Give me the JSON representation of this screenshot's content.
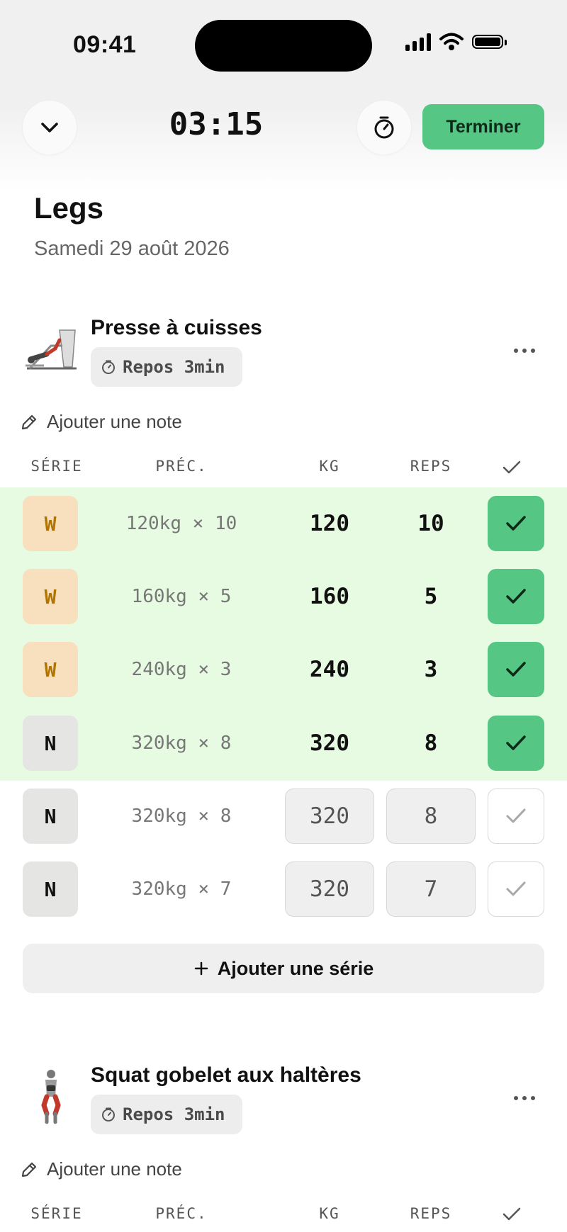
{
  "status_bar": {
    "time": "09:41"
  },
  "header": {
    "timer": "03:15",
    "finish_label": "Terminer"
  },
  "workout": {
    "title": "Legs",
    "date": "Samedi 29 août 2026"
  },
  "columns": {
    "set": "SÉRIE",
    "prev": "PRÉC.",
    "kg": "KG",
    "reps": "REPS"
  },
  "exercises": [
    {
      "name": "Presse à cuisses",
      "rest": "Repos 3min",
      "note_label": "Ajouter une note",
      "sets": [
        {
          "type": "W",
          "prev": "120kg × 10",
          "kg": "120",
          "reps": "10",
          "done": true
        },
        {
          "type": "W",
          "prev": "160kg × 5",
          "kg": "160",
          "reps": "5",
          "done": true
        },
        {
          "type": "W",
          "prev": "240kg × 3",
          "kg": "240",
          "reps": "3",
          "done": true
        },
        {
          "type": "N",
          "prev": "320kg × 8",
          "kg": "320",
          "reps": "8",
          "done": true
        },
        {
          "type": "N",
          "prev": "320kg × 8",
          "kg": "320",
          "reps": "8",
          "done": false
        },
        {
          "type": "N",
          "prev": "320kg × 7",
          "kg": "320",
          "reps": "7",
          "done": false
        }
      ],
      "add_set_label": "Ajouter une série"
    },
    {
      "name": "Squat gobelet aux haltères",
      "rest": "Repos 3min",
      "note_label": "Ajouter une note"
    }
  ],
  "icons": [
    "chevron-down-icon",
    "stopwatch-icon",
    "more-icon",
    "pencil-icon",
    "check-icon",
    "plus-icon"
  ],
  "colors": {
    "accent_green": "#55c684",
    "done_row_bg": "#e7fbe2",
    "warmup_bg": "#f8dfbd",
    "warmup_text": "#b07400"
  }
}
